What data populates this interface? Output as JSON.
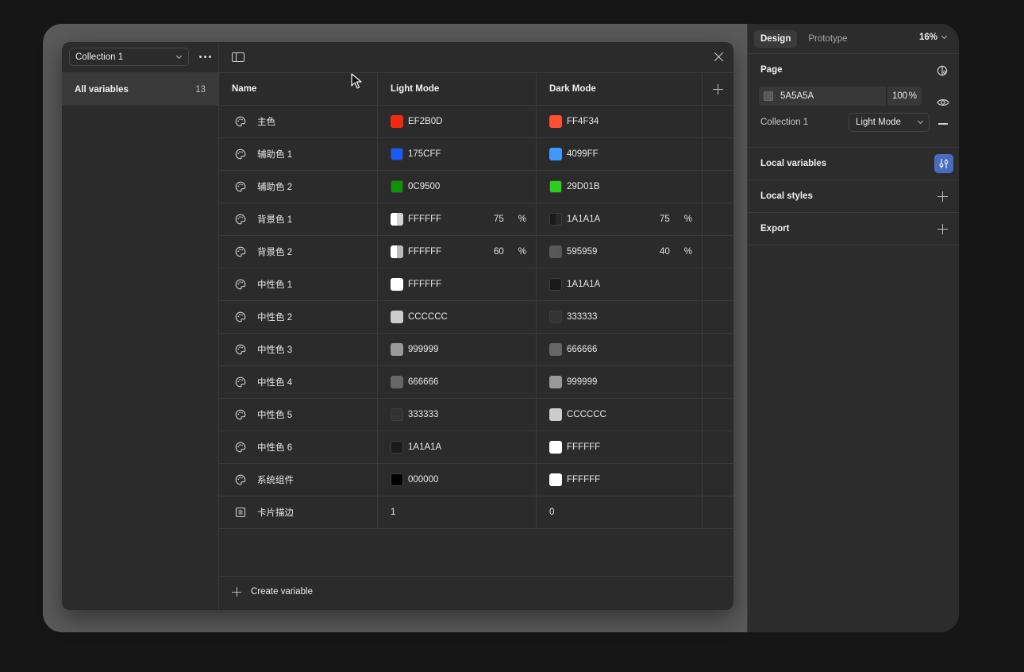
{
  "modal": {
    "collection_select": "Collection 1",
    "sidebar": {
      "all_variables_label": "All variables",
      "all_variables_count": "13"
    },
    "headers": {
      "name": "Name",
      "light": "Light Mode",
      "dark": "Dark Mode"
    },
    "rows": [
      {
        "icon": "palette-icon",
        "name": "主色",
        "light": {
          "hex": "EF2B0D",
          "color": "#EF2B0D",
          "pct": ""
        },
        "dark": {
          "hex": "FF4F34",
          "color": "#FF4F34",
          "pct": ""
        }
      },
      {
        "icon": "palette-icon",
        "name": "辅助色 1",
        "light": {
          "hex": "175CFF",
          "color": "#175CFF",
          "pct": ""
        },
        "dark": {
          "hex": "4099FF",
          "color": "#4099FF",
          "pct": ""
        }
      },
      {
        "icon": "palette-icon",
        "name": "辅助色 2",
        "light": {
          "hex": "0C9500",
          "color": "#0C9500",
          "pct": ""
        },
        "dark": {
          "hex": "29D01B",
          "color": "#29D01B",
          "pct": ""
        }
      },
      {
        "icon": "palette-icon",
        "name": "背景色 1",
        "light": {
          "hex": "FFFFFF",
          "color": "#FFFFFF",
          "pct": "75"
        },
        "dark": {
          "hex": "1A1A1A",
          "color": "#1A1A1A",
          "pct": "75"
        }
      },
      {
        "icon": "palette-icon",
        "name": "背景色 2",
        "light": {
          "hex": "FFFFFF",
          "color": "#FFFFFF",
          "pct": "60"
        },
        "dark": {
          "hex": "595959",
          "color": "#595959",
          "pct": "40"
        }
      },
      {
        "icon": "palette-icon",
        "name": "中性色 1",
        "light": {
          "hex": "FFFFFF",
          "color": "#FFFFFF",
          "pct": ""
        },
        "dark": {
          "hex": "1A1A1A",
          "color": "#1A1A1A",
          "pct": ""
        }
      },
      {
        "icon": "palette-icon",
        "name": "中性色 2",
        "light": {
          "hex": "CCCCCC",
          "color": "#CCCCCC",
          "pct": ""
        },
        "dark": {
          "hex": "333333",
          "color": "#333333",
          "pct": ""
        }
      },
      {
        "icon": "palette-icon",
        "name": "中性色 3",
        "light": {
          "hex": "999999",
          "color": "#999999",
          "pct": ""
        },
        "dark": {
          "hex": "666666",
          "color": "#666666",
          "pct": ""
        }
      },
      {
        "icon": "palette-icon",
        "name": "中性色 4",
        "light": {
          "hex": "666666",
          "color": "#666666",
          "pct": ""
        },
        "dark": {
          "hex": "999999",
          "color": "#999999",
          "pct": ""
        }
      },
      {
        "icon": "palette-icon",
        "name": "中性色 5",
        "light": {
          "hex": "333333",
          "color": "#333333",
          "pct": ""
        },
        "dark": {
          "hex": "CCCCCC",
          "color": "#CCCCCC",
          "pct": ""
        }
      },
      {
        "icon": "palette-icon",
        "name": "中性色 6",
        "light": {
          "hex": "1A1A1A",
          "color": "#1A1A1A",
          "pct": ""
        },
        "dark": {
          "hex": "FFFFFF",
          "color": "#FFFFFF",
          "pct": ""
        }
      },
      {
        "icon": "palette-icon",
        "name": "系统组件",
        "light": {
          "hex": "000000",
          "color": "#000000",
          "pct": ""
        },
        "dark": {
          "hex": "FFFFFF",
          "color": "#FFFFFF",
          "pct": ""
        }
      },
      {
        "icon": "number-icon",
        "name": "卡片描边",
        "light": {
          "value": "1"
        },
        "dark": {
          "value": "0"
        }
      }
    ],
    "pct_sign": "%",
    "create_label": "Create variable"
  },
  "design_panel": {
    "tabs": [
      "Design",
      "Prototype"
    ],
    "zoom": "16%",
    "page_title": "Page",
    "fill_hex": "5A5A5A",
    "fill_pct": "100",
    "pct_sign": "%",
    "collection_label": "Collection 1",
    "mode_select": "Light Mode",
    "local_variables": "Local variables",
    "local_styles": "Local styles",
    "export": "Export"
  },
  "colors": {
    "canvas": "#5A5A5A",
    "accent": "#4A6BBF"
  }
}
